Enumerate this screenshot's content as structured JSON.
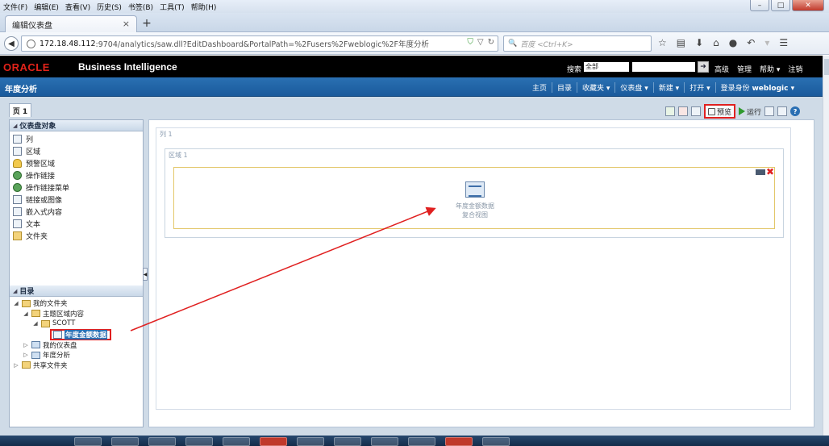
{
  "browser": {
    "menu": [
      "文件(F)",
      "编辑(E)",
      "查看(V)",
      "历史(S)",
      "书签(B)",
      "工具(T)",
      "帮助(H)"
    ],
    "tab_title": "编辑仪表盘",
    "url_host": "172.18.48.112",
    "url_rest": ":9704/analytics/saw.dll?EditDashboard&PortalPath=%2Fusers%2Fweblogic%2F年度分析",
    "search_placeholder": "百度 <Ctrl+K>"
  },
  "obi_header": {
    "brand": "ORACLE",
    "product": "Business Intelligence",
    "search_label": "搜索",
    "search_scope": "全部",
    "links": [
      "高级",
      "管理",
      "帮助 ▾",
      "注销"
    ]
  },
  "dashbar": {
    "title": "年度分析",
    "links": [
      "主页",
      "目录",
      "收藏夹 ▾",
      "仪表盘 ▾",
      "新建 ▾",
      "打开 ▾"
    ],
    "signed_in_label": "登录身份",
    "user": "weblogic ▾"
  },
  "editor": {
    "page_tab": "页 1",
    "preview_label": "预览",
    "run_label": "运行"
  },
  "objects_panel": {
    "title": "仪表盘对象",
    "items": [
      {
        "label": "列",
        "icon": "column-icon"
      },
      {
        "label": "区域",
        "icon": "section-icon"
      },
      {
        "label": "预警区域",
        "icon": "bell-icon"
      },
      {
        "label": "操作链接",
        "icon": "action-link-icon"
      },
      {
        "label": "操作链接菜单",
        "icon": "action-menu-icon"
      },
      {
        "label": "链接或图像",
        "icon": "link-image-icon"
      },
      {
        "label": "嵌入式内容",
        "icon": "embedded-icon"
      },
      {
        "label": "文本",
        "icon": "text-icon"
      },
      {
        "label": "文件夹",
        "icon": "folder-icon"
      }
    ]
  },
  "catalog_panel": {
    "title": "目录",
    "tree": {
      "my_folders": "我的文件夹",
      "subject_area": "主题区域内容",
      "scott": "SCOTT",
      "analysis": "年度金额数据",
      "my_dashboard": "我的仪表盘",
      "annual": "年度分析",
      "shared": "共享文件夹"
    }
  },
  "canvas": {
    "column_label": "列 1",
    "section_label": "区域 1",
    "report_name": "年度金额数据",
    "report_view": "复合视图"
  }
}
